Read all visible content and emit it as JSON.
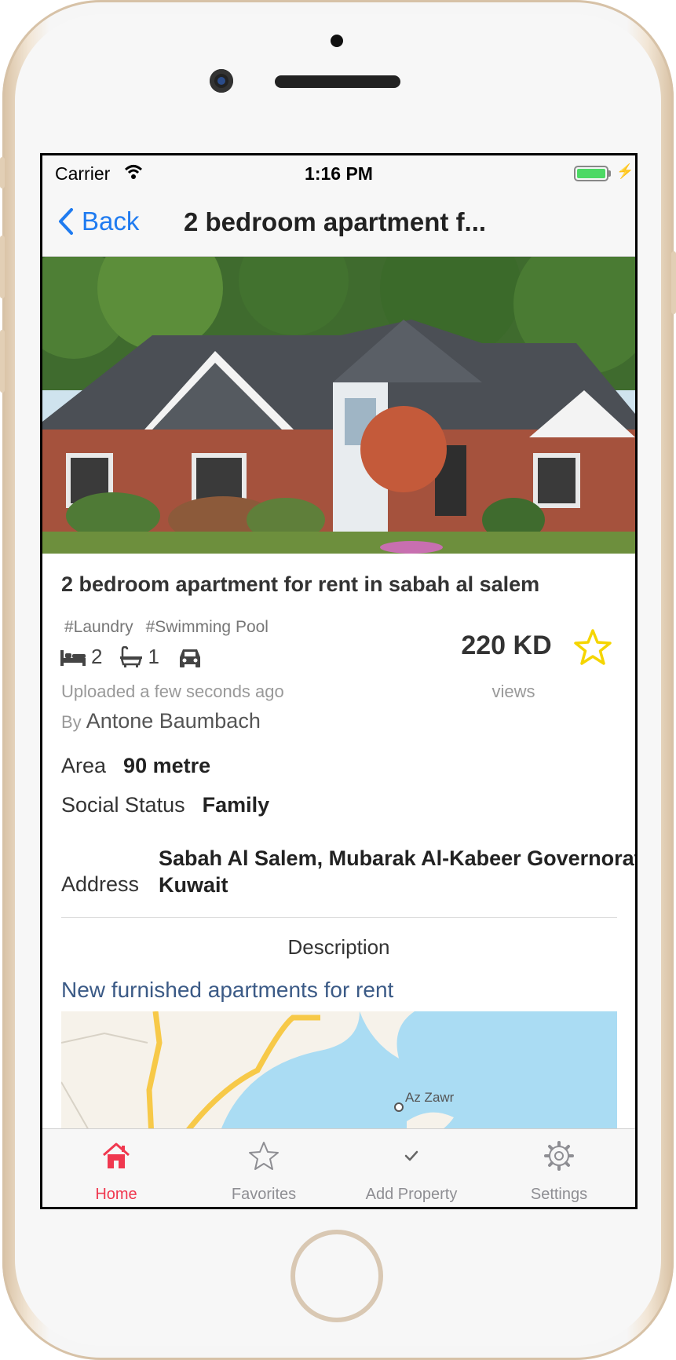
{
  "status_bar": {
    "carrier": "Carrier",
    "time": "1:16 PM"
  },
  "nav": {
    "back_label": "Back",
    "title": "2 bedroom apartment f..."
  },
  "listing": {
    "title": "2 bedroom apartment for rent in sabah al salem",
    "tags": [
      "#Laundry",
      "#Swimming Pool"
    ],
    "bedrooms": "2",
    "bathrooms": "1",
    "price": "220 KD",
    "views_label": "views",
    "uploaded": "Uploaded a few seconds ago",
    "by_label": "By",
    "author": "Antone Baumbach",
    "favorited": false
  },
  "details": {
    "area_label": "Area",
    "area_value": "90 metre",
    "social_label": "Social Status",
    "social_value": "Family",
    "address_label": "Address",
    "address_line1": "Sabah Al Salem, Mubarak Al-Kabeer Governorate,",
    "address_line2": "Kuwait"
  },
  "description": {
    "heading": "Description",
    "text": "New furnished apartments for rent"
  },
  "map": {
    "place_label": "Az Zawr"
  },
  "tab_bar": {
    "tabs": [
      {
        "label": "Home",
        "icon": "home-icon",
        "active": true
      },
      {
        "label": "Favorites",
        "icon": "star-icon",
        "active": false
      },
      {
        "label": "Add Property",
        "icon": "checkmark-icon",
        "active": false
      },
      {
        "label": "Settings",
        "icon": "gear-icon",
        "active": false
      }
    ]
  },
  "colors": {
    "accent_blue": "#1f7bf0",
    "active_tab": "#f0384f",
    "star_yellow": "#f5d500",
    "description_text": "#3b5a86"
  }
}
